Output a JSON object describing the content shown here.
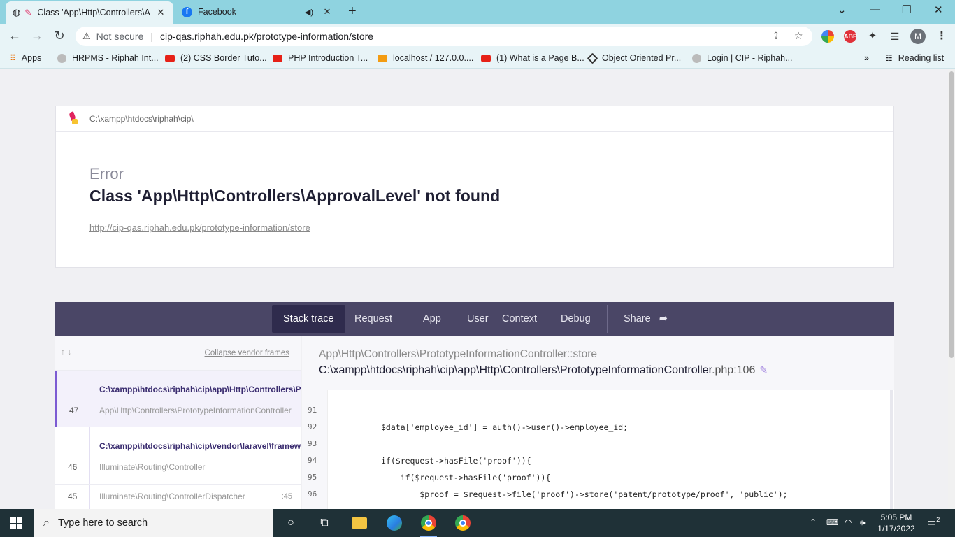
{
  "browser": {
    "tabs": [
      {
        "title": "Class 'App\\Http\\Controllers\\A",
        "active": true
      },
      {
        "title": "Facebook",
        "active": false
      }
    ],
    "security_label": "Not secure",
    "url": "cip-qas.riphah.edu.pk/prototype-information/store",
    "bookmarks": [
      {
        "label": "Apps",
        "icon": "apps-grid-icon"
      },
      {
        "label": "HRPMS - Riphah Int...",
        "icon": "page-icon"
      },
      {
        "label": "(2) CSS Border Tuto...",
        "icon": "youtube-icon"
      },
      {
        "label": "PHP Introduction T...",
        "icon": "youtube-icon"
      },
      {
        "label": "localhost / 127.0.0....",
        "icon": "phpmyadmin-icon"
      },
      {
        "label": "(1) What is a Page B...",
        "icon": "youtube-icon"
      },
      {
        "label": "Object Oriented Pr...",
        "icon": "diamond-icon"
      },
      {
        "label": "Login | CIP - Riphah...",
        "icon": "page-icon"
      }
    ],
    "overflow_label": "»",
    "reading_list_label": "Reading list",
    "profile_initial": "M",
    "abp_label": "ABP"
  },
  "error_page": {
    "app_path": "C:\\xampp\\htdocs\\riphah\\cip\\",
    "error_label": "Error",
    "error_message": "Class 'App\\Http\\Controllers\\ApprovalLevel' not found",
    "request_url": "http://cip-qas.riphah.edu.pk/prototype-information/store",
    "nav_tabs": [
      "Stack trace",
      "Request",
      "App",
      "User",
      "Context",
      "Debug"
    ],
    "share_label": "Share",
    "collapse_label": "Collapse vendor frames",
    "frames": [
      {
        "number": "47",
        "file": "C:\\xampp\\htdocs\\riphah\\cip\\app\\Http\\Controllers\\P",
        "class": "App\\Http\\Controllers\\PrototypeInformationController",
        "line": ""
      },
      {
        "number": "46",
        "file": "C:\\xampp\\htdocs\\riphah\\cip\\vendor\\laravel\\framew",
        "class": "Illuminate\\Routing\\Controller",
        "line": ""
      },
      {
        "number": "45",
        "file": "",
        "class": "Illuminate\\Routing\\ControllerDispatcher",
        "line": ":45"
      }
    ],
    "selected_frame": {
      "class_method": "App\\Http\\Controllers\\PrototypeInformationController::store",
      "file": "C:\\xampp\\htdocs\\riphah\\cip\\app\\Http\\Controllers\\PrototypeInformationController",
      "extension_line": ".php:106"
    },
    "code_lines": [
      {
        "n": "91",
        "text": ""
      },
      {
        "n": "92",
        "text": "$data['employee_id'] = auth()->user()->employee_id;"
      },
      {
        "n": "93",
        "text": ""
      },
      {
        "n": "94",
        "text": "if($request->hasFile('proof')){"
      },
      {
        "n": "95",
        "text": "    if($request->hasFile('proof')){"
      },
      {
        "n": "96",
        "text": "        $proof = $request->file('proof')->store('patent/prototype/proof', 'public');"
      }
    ]
  },
  "taskbar": {
    "search_placeholder": "Type here to search",
    "time": "5:05 PM",
    "date": "1/17/2022",
    "notification_count": "2"
  }
}
